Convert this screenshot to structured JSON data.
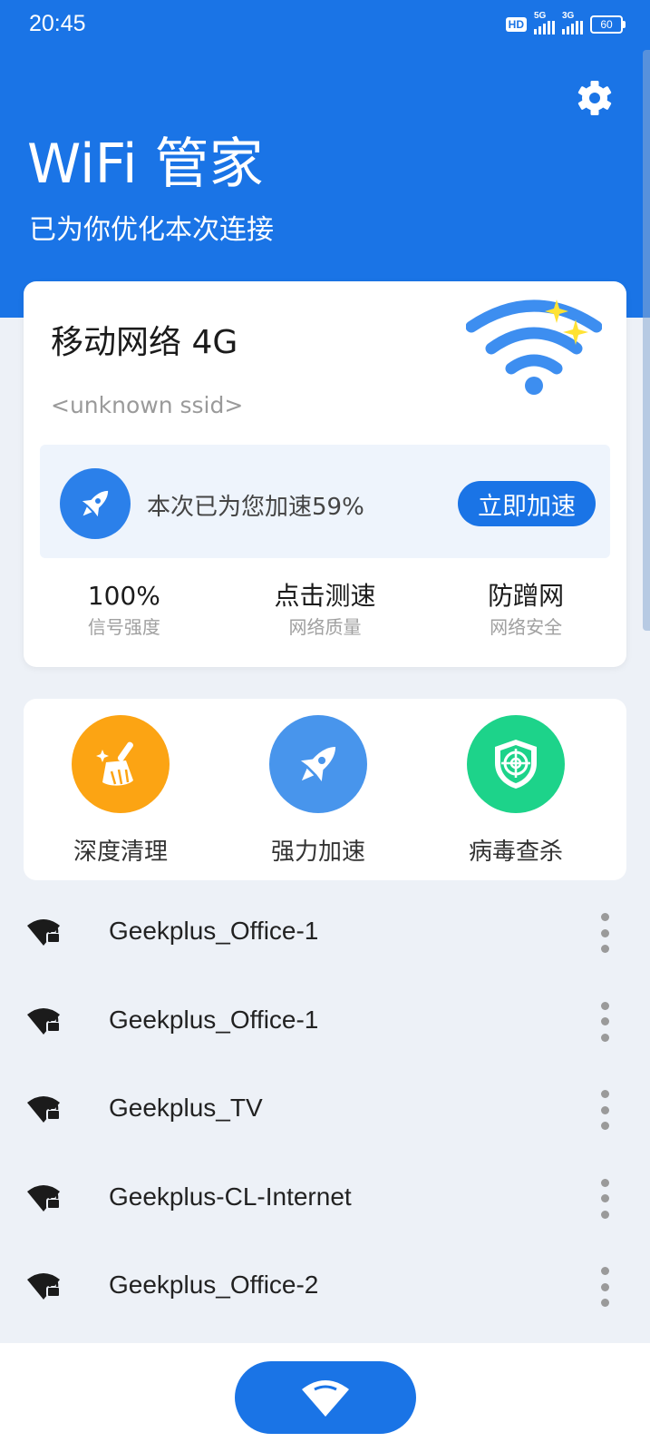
{
  "status_bar": {
    "time": "20:45",
    "hd_label": "HD",
    "signal_1_label": "5G",
    "signal_2_label": "3G",
    "battery": "60"
  },
  "header": {
    "title": "WiFi 管家",
    "subtitle": "已为你优化本次连接"
  },
  "network_card": {
    "name": "移动网络 4G",
    "ssid": "<unknown ssid>",
    "boost_text": "本次已为您加速59%",
    "boost_button": "立即加速",
    "stats": [
      {
        "value": "100%",
        "label": "信号强度"
      },
      {
        "value": "点击测速",
        "label": "网络质量"
      },
      {
        "value": "防蹭网",
        "label": "网络安全"
      }
    ]
  },
  "tools": [
    {
      "label": "深度清理",
      "icon": "broom-icon",
      "color": "#fca413"
    },
    {
      "label": "强力加速",
      "icon": "rocket-icon",
      "color": "#4895ec"
    },
    {
      "label": "病毒查杀",
      "icon": "shield-icon",
      "color": "#1dd38a"
    }
  ],
  "wifi_list": [
    {
      "ssid": "Geekplus_Office-1"
    },
    {
      "ssid": "Geekplus_Office-1"
    },
    {
      "ssid": "Geekplus_TV"
    },
    {
      "ssid": "Geekplus-CL-Internet"
    },
    {
      "ssid": "Geekplus_Office-2"
    }
  ],
  "colors": {
    "primary": "#1a74e6",
    "background": "#edf1f7"
  }
}
